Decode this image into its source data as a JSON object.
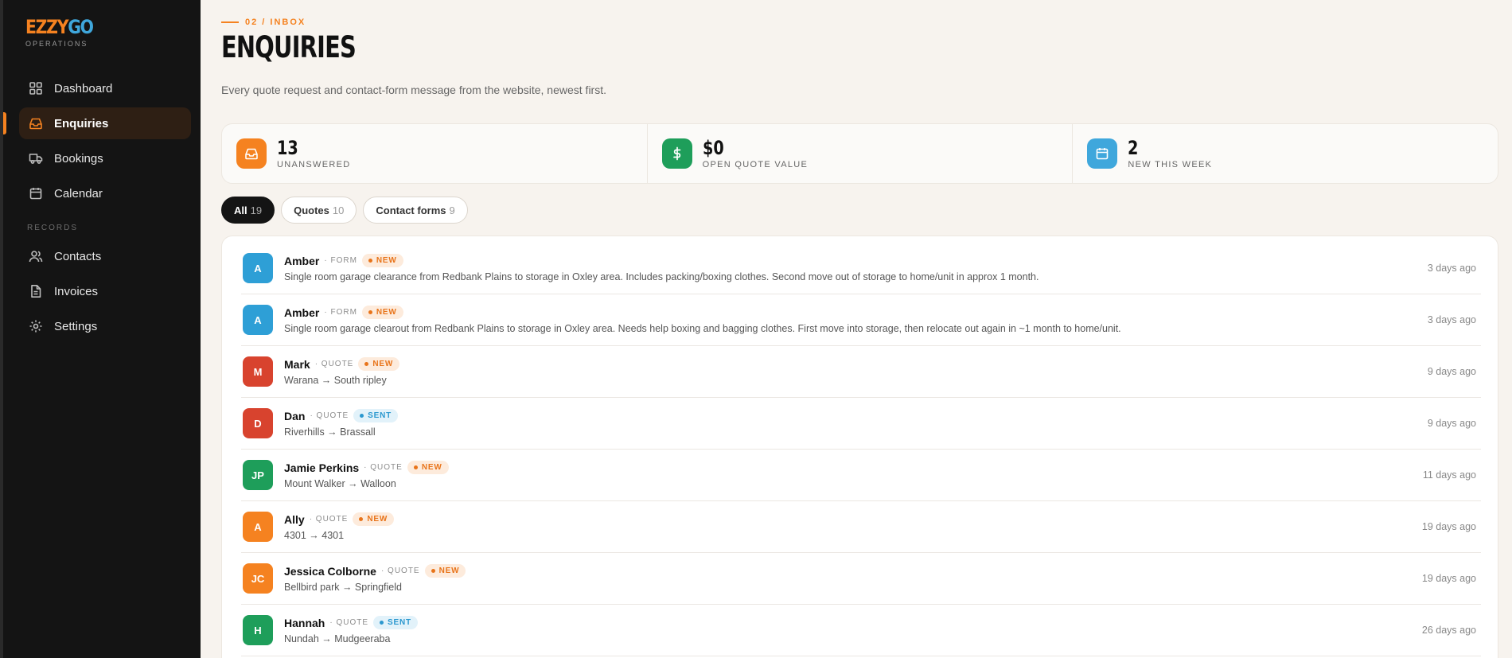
{
  "brand": {
    "logo_a": "EZZY",
    "logo_b": "GO",
    "sub": "OPERATIONS"
  },
  "nav": {
    "items": [
      {
        "label": "Dashboard",
        "icon": "grid-icon"
      },
      {
        "label": "Enquiries",
        "icon": "inbox-icon",
        "active": true
      },
      {
        "label": "Bookings",
        "icon": "truck-icon"
      },
      {
        "label": "Calendar",
        "icon": "calendar-icon"
      }
    ],
    "records_heading": "RECORDS",
    "records": [
      {
        "label": "Contacts",
        "icon": "users-icon"
      },
      {
        "label": "Invoices",
        "icon": "file-icon"
      },
      {
        "label": "Settings",
        "icon": "gear-icon"
      }
    ]
  },
  "header": {
    "crumb": "02 / INBOX",
    "title": "ENQUIRIES",
    "subtitle": "Every quote request and contact-form message from the website, newest first."
  },
  "stats": [
    {
      "value": "13",
      "label": "UNANSWERED",
      "icon": "inbox-icon",
      "color": "#f58220"
    },
    {
      "value": "$0",
      "label": "OPEN QUOTE VALUE",
      "icon": "dollar-icon",
      "color": "#1e9e5a"
    },
    {
      "value": "2",
      "label": "NEW THIS WEEK",
      "icon": "calendar-icon",
      "color": "#3fa7dc"
    }
  ],
  "filters": [
    {
      "label": "All",
      "count": "19",
      "active": true
    },
    {
      "label": "Quotes",
      "count": "10"
    },
    {
      "label": "Contact forms",
      "count": "9"
    }
  ],
  "enquiries": [
    {
      "initials": "A",
      "name": "Amber",
      "type": "· FORM",
      "status": "NEW",
      "desc": "Single room garage clearance from Redbank Plains to storage in Oxley area. Includes packing/boxing clothes. Second move out of storage to home/unit in approx 1 month.",
      "time": "3 days ago",
      "color": "#2e9fd6"
    },
    {
      "initials": "A",
      "name": "Amber",
      "type": "· FORM",
      "status": "NEW",
      "desc": "Single room garage clearout from Redbank Plains to storage in Oxley area. Needs help boxing and bagging clothes. First move into storage, then relocate out again in ~1 month to home/unit.",
      "time": "3 days ago",
      "color": "#2e9fd6"
    },
    {
      "initials": "M",
      "name": "Mark",
      "type": "· QUOTE",
      "status": "NEW",
      "desc": "Warana → South ripley",
      "time": "9 days ago",
      "color": "#d8432e"
    },
    {
      "initials": "D",
      "name": "Dan",
      "type": "· QUOTE",
      "status": "SENT",
      "desc": "Riverhills → Brassall",
      "time": "9 days ago",
      "color": "#d8432e"
    },
    {
      "initials": "JP",
      "name": "Jamie Perkins",
      "type": "· QUOTE",
      "status": "NEW",
      "desc": "Mount Walker → Walloon",
      "time": "11 days ago",
      "color": "#1e9e5a"
    },
    {
      "initials": "A",
      "name": "Ally",
      "type": "· QUOTE",
      "status": "NEW",
      "desc": "4301 → 4301",
      "time": "19 days ago",
      "color": "#f58220"
    },
    {
      "initials": "JC",
      "name": "Jessica Colborne",
      "type": "· QUOTE",
      "status": "NEW",
      "desc": "Bellbird park → Springfield",
      "time": "19 days ago",
      "color": "#f58220"
    },
    {
      "initials": "H",
      "name": "Hannah",
      "type": "· QUOTE",
      "status": "SENT",
      "desc": "Nundah → Mudgeeraba",
      "time": "26 days ago",
      "color": "#1e9e5a"
    }
  ]
}
